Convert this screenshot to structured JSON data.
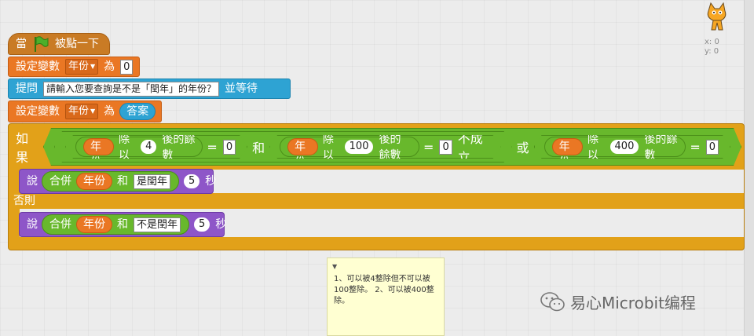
{
  "stage": {
    "x_label": "x: 0",
    "y_label": "y: 0",
    "sprite_icon": "scratch-cat-icon"
  },
  "script": {
    "hat": {
      "prefix": "當",
      "icon": "green-flag-icon",
      "suffix": "被點一下"
    },
    "set_var_1": {
      "label": "設定變數",
      "variable": "年份",
      "to": "為",
      "value": "0"
    },
    "ask": {
      "label": "提問",
      "question": "請輸入您要查詢是不是「閏年」的年份？",
      "suffix": "並等待"
    },
    "set_var_2": {
      "label": "設定變數",
      "variable": "年份",
      "to": "為",
      "answer": "答案"
    },
    "if_else": {
      "if_label": "如果",
      "cond1": {
        "var": "年份",
        "op": "除以",
        "num": "4",
        "suffix": "後的餘數",
        "eq": "=",
        "rhs": "0"
      },
      "and": "和",
      "cond2": {
        "var": "年份",
        "op": "除以",
        "num": "100",
        "suffix": "後的餘數",
        "eq": "=",
        "rhs": "0",
        "not": "不成立"
      },
      "or": "或",
      "cond3": {
        "var": "年份",
        "op": "除以",
        "num": "400",
        "suffix": "後的餘數",
        "eq": "=",
        "rhs": "0"
      },
      "then_say": {
        "label": "說",
        "join": "合併",
        "var": "年份",
        "and": "和",
        "text": "是閏年",
        "secs": "5",
        "unit": "秒"
      },
      "else_label": "否則",
      "else_say": {
        "label": "說",
        "join": "合併",
        "var": "年份",
        "and": "和",
        "text": "不是閏年",
        "secs": "5",
        "unit": "秒"
      }
    }
  },
  "comment": {
    "text": "1、可以被4整除但不可以被100整除。 2、可以被400整除。"
  },
  "watermark": {
    "text": "易心Microbit编程",
    "icon": "wechat-icon"
  }
}
